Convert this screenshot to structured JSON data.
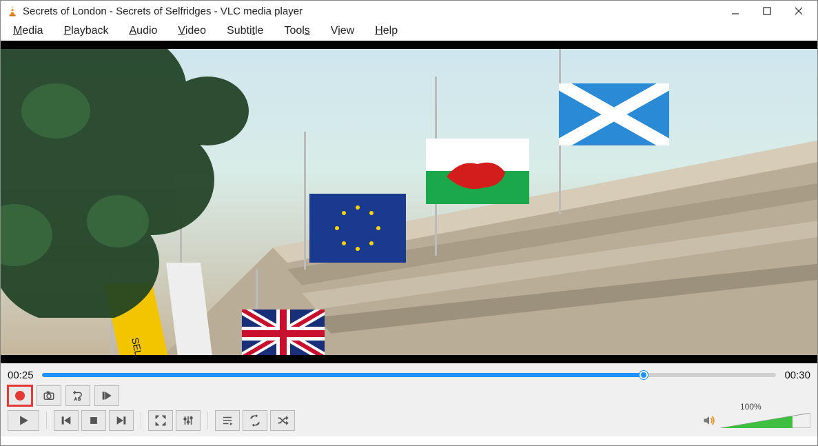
{
  "window": {
    "title": "Secrets of London - Secrets of Selfridges - VLC media player"
  },
  "menu": {
    "media": {
      "pre": "",
      "u": "M",
      "post": "edia"
    },
    "playback": {
      "pre": "",
      "u": "P",
      "post": "layback"
    },
    "audio": {
      "pre": "",
      "u": "A",
      "post": "udio"
    },
    "video": {
      "pre": "",
      "u": "V",
      "post": "ideo"
    },
    "subtitle": {
      "pre": "Subti",
      "u": "t",
      "post": "le"
    },
    "tools": {
      "pre": "Tool",
      "u": "s",
      "post": ""
    },
    "view": {
      "pre": "V",
      "u": "i",
      "post": "ew"
    },
    "help": {
      "pre": "",
      "u": "H",
      "post": "elp"
    }
  },
  "playback": {
    "elapsed": "00:25",
    "total": "00:30"
  },
  "volume": {
    "percent_label": "100%"
  }
}
